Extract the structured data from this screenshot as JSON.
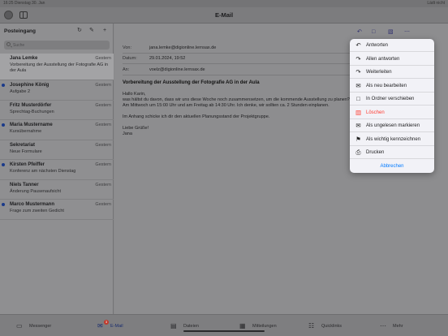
{
  "status_bar": {
    "time_date": "16:25   Dienstag 30. Jan",
    "right": "Lädt nicht"
  },
  "app": {
    "title": "E-Mail"
  },
  "sidebar": {
    "heading": "Posteingang",
    "search_placeholder": "Suche",
    "mails": [
      {
        "from": "Jana Lemke",
        "date": "Gestern",
        "subject": "Vorbereitung der Ausstellung der Fotografie AG in der Aula",
        "unread": false,
        "selected": true
      },
      {
        "from": "Josephine König",
        "date": "Gestern",
        "subject": "Aufgabe 2",
        "unread": true,
        "selected": false
      },
      {
        "from": "Fritz Musterdörfer",
        "date": "Gestern",
        "subject": "Sprechtag-Buchungen",
        "unread": false,
        "selected": false
      },
      {
        "from": "Maria Mustername",
        "date": "Gestern",
        "subject": "Kursübernahme",
        "unread": true,
        "selected": false
      },
      {
        "from": "Sekretariat",
        "date": "Gestern",
        "subject": "Neue Formulare",
        "unread": false,
        "selected": false
      },
      {
        "from": "Kirsten Pfeiffer",
        "date": "Gestern",
        "subject": "Konferenz am nächsten Dienstag",
        "unread": true,
        "selected": false
      },
      {
        "from": "Niels Tanner",
        "date": "Gestern",
        "subject": "Änderung Pausenaufsicht",
        "unread": false,
        "selected": false
      },
      {
        "from": "Marco Mustermann",
        "date": "Gestern",
        "subject": "Frage zum zweiten Gedicht",
        "unread": true,
        "selected": false
      }
    ]
  },
  "message": {
    "from_label": "Von:",
    "from": "jana.lemke@digionline.lernsax.de",
    "date_label": "Datum:",
    "date": "29.01.2024, 19:52",
    "to_label": "An:",
    "to": "voelz@digionline.lernsax.de",
    "title": "Vorbereitung der Ausstellung der Fotografie AG in der Aula",
    "greeting": "Hallo Karin,",
    "line1": "was hältst du davon, dass wir uns diese Woche noch zusammensetzen, um die kommende Ausstellung zu planen?",
    "line2": "Am Mittwoch um 15:00 Uhr und am Freitag ab 14:30 Uhr. Ich denke, wir sollten ca. 2 Stunden einplanen.",
    "line3": "Im Anhang schicke ich dir den aktuellen Planungsstand der Projektgruppe.",
    "closing": "Liebe Grüße!",
    "signature": "Jana"
  },
  "context_menu": {
    "items": [
      {
        "label": "Antworten",
        "icon": "reply-icon",
        "danger": false
      },
      {
        "label": "Allen antworten",
        "icon": "reply-all-icon",
        "danger": false
      },
      {
        "label": "Weiterleiten",
        "icon": "forward-icon",
        "danger": false
      },
      {
        "label": "Als neu bearbeiten",
        "icon": "envelope-edit-icon",
        "danger": false
      },
      {
        "label": "In Ordner verschieben",
        "icon": "folder-icon",
        "danger": false
      },
      {
        "label": "Löschen",
        "icon": "trash-icon",
        "danger": true
      },
      {
        "label": "Als ungelesen markieren",
        "icon": "envelope-icon",
        "danger": false
      },
      {
        "label": "Als wichtig kennzeichnen",
        "icon": "flag-icon",
        "danger": false
      },
      {
        "label": "Drucken",
        "icon": "printer-icon",
        "danger": false
      }
    ],
    "cancel": "Abbrechen"
  },
  "tabbar": {
    "tabs": [
      {
        "label": "Messenger",
        "icon": "messenger-icon",
        "active": false,
        "badge": ""
      },
      {
        "label": "E-Mail",
        "icon": "mail-icon",
        "active": true,
        "badge": "3"
      },
      {
        "label": "Dateien",
        "icon": "files-icon",
        "active": false,
        "badge": ""
      },
      {
        "label": "Mitteilungen",
        "icon": "notifications-icon",
        "active": false,
        "badge": ""
      },
      {
        "label": "Quicklinks",
        "icon": "quicklinks-icon",
        "active": false,
        "badge": ""
      },
      {
        "label": "Mehr",
        "icon": "more-icon",
        "active": false,
        "badge": ""
      }
    ]
  },
  "colors": {
    "accent": "#007aff",
    "danger": "#ff3b30",
    "unread_dot": "#1a3a8a"
  }
}
